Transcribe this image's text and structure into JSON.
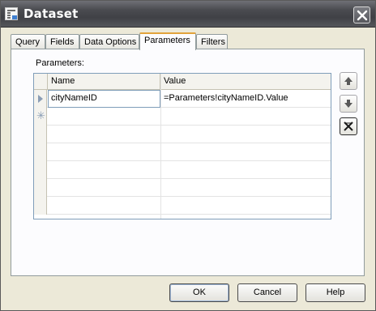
{
  "window": {
    "title": "Dataset"
  },
  "tabs": [
    {
      "label": "Query"
    },
    {
      "label": "Fields"
    },
    {
      "label": "Data Options"
    },
    {
      "label": "Parameters"
    },
    {
      "label": "Filters"
    }
  ],
  "active_tab": "Parameters",
  "parameters": {
    "section_label": "Parameters:",
    "columns": [
      "Name",
      "Value"
    ],
    "rows": [
      {
        "name": "cityNameID",
        "value": "=Parameters!cityNameID.Value"
      }
    ]
  },
  "buttons": {
    "ok": "OK",
    "cancel": "Cancel",
    "help": "Help"
  },
  "icons": {
    "move_up": "arrow-up-icon",
    "move_down": "arrow-down-icon",
    "delete": "delete-x-icon",
    "window": "dataset-window-icon",
    "close": "close-icon"
  },
  "colors": {
    "active_tab_accent": "#e2a33b",
    "titlebar": "#4a4b50",
    "grid_border": "#7f9db9"
  }
}
